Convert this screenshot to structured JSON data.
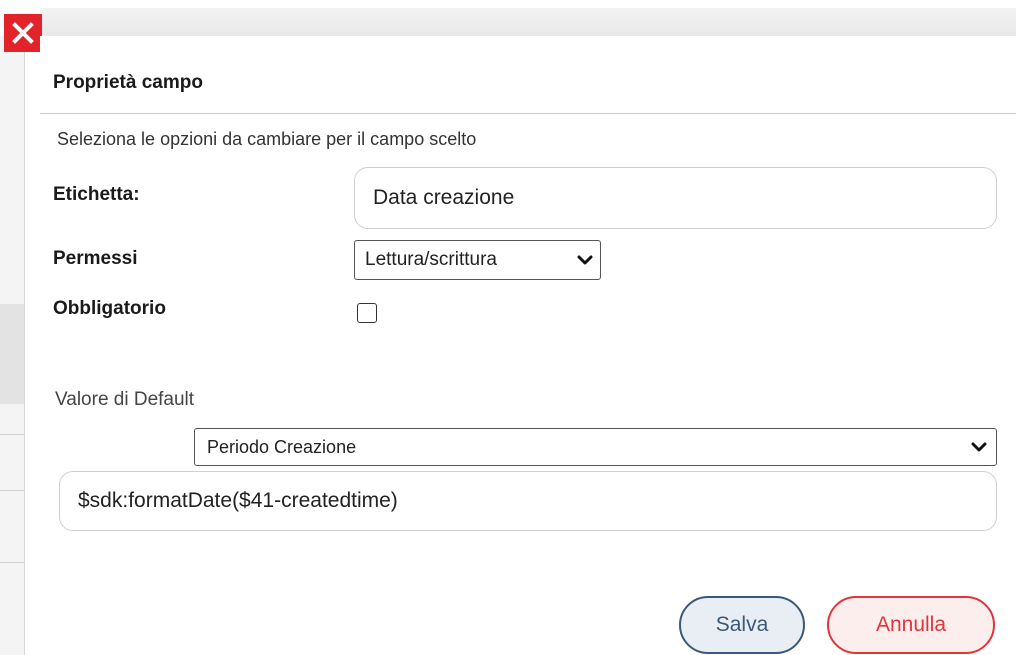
{
  "dialog": {
    "title": "Proprietà campo",
    "subtitle": "Seleziona le opzioni da cambiare per il campo scelto"
  },
  "fields": {
    "label": {
      "name": "Etichetta:",
      "value": "Data creazione"
    },
    "permissions": {
      "name": "Permessi",
      "selected": "Lettura/scrittura"
    },
    "mandatory": {
      "name": "Obbligatorio",
      "checked": false
    }
  },
  "default_value": {
    "section_label": "Valore di Default",
    "selected": "Periodo Creazione",
    "expression": "$sdk:formatDate($41-createdtime)"
  },
  "buttons": {
    "save": "Salva",
    "cancel": "Annulla"
  },
  "icons": {
    "close": "close-icon",
    "dropdown": "chevron-down-icon"
  },
  "colors": {
    "close_bg": "#e3232a",
    "save_accent": "#39597a",
    "cancel_accent": "#e0353d"
  }
}
